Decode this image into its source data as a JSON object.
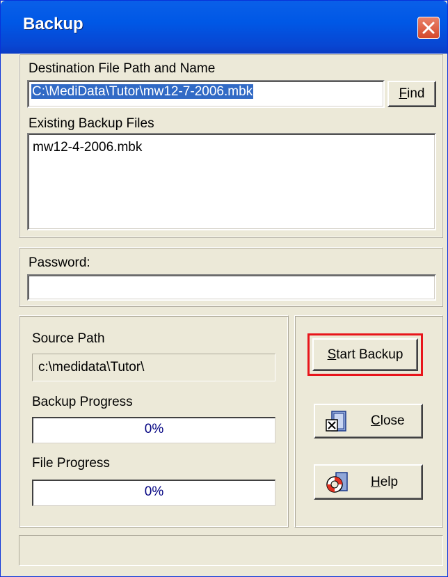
{
  "window": {
    "title": "Backup"
  },
  "destination": {
    "label": "Destination File Path and Name",
    "value": "C:\\MediData\\Tutor\\mw12-7-2006.mbk",
    "find_label_u": "F",
    "find_label_rest": "ind"
  },
  "existing": {
    "label": "Existing Backup Files",
    "files": [
      "mw12-4-2006.mbk"
    ]
  },
  "password": {
    "label": "Password:",
    "value": ""
  },
  "source": {
    "label": "Source Path",
    "value": "c:\\medidata\\Tutor\\"
  },
  "backup_progress": {
    "label": "Backup Progress",
    "text": "0%",
    "value": 0
  },
  "file_progress": {
    "label": "File Progress",
    "text": "0%",
    "value": 0
  },
  "buttons": {
    "start_u": "S",
    "start_rest": "tart Backup",
    "close_u": "C",
    "close_rest": "lose",
    "help_u": "H",
    "help_rest": "elp"
  },
  "colors": {
    "highlight": "#E8151B",
    "title_bar": "#0058E6",
    "selection": "#316AC5"
  }
}
